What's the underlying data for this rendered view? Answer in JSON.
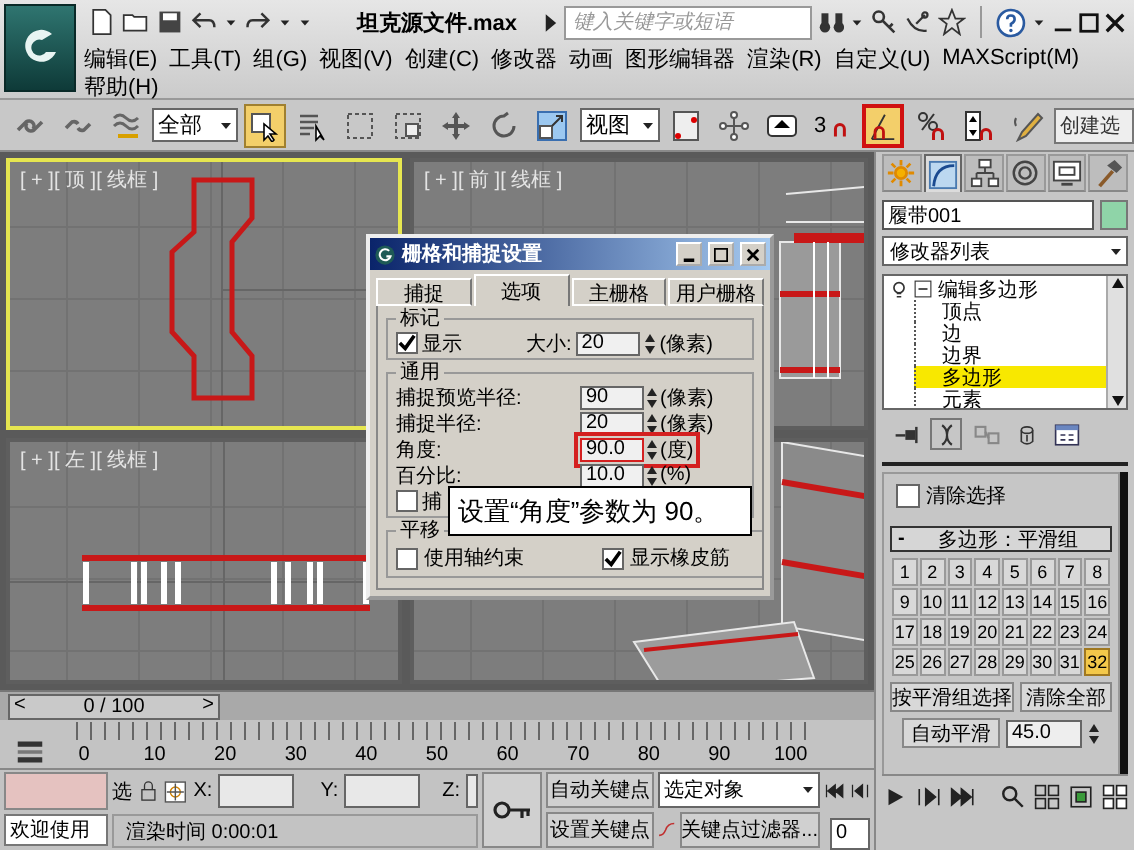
{
  "title_bar": {
    "title": "坦克源文件.max",
    "search": {
      "placeholder": "键入关键字或短语"
    }
  },
  "menu_rows": [
    [
      "编辑(E)",
      "工具(T)",
      "组(G)",
      "视图(V)",
      "创建(C)",
      "修改器",
      "动画",
      "图形编辑器",
      "渲染(R)",
      "自定义(U)",
      "MAXScript(M)"
    ],
    [
      "帮助(H)"
    ]
  ],
  "toolbar": [
    {
      "kind": "link",
      "active": false,
      "highlighted": false
    },
    {
      "kind": "unlink",
      "active": false,
      "highlighted": false
    },
    {
      "kind": "bind",
      "active": false,
      "highlighted": false
    },
    {
      "kind": "dropdown",
      "value": "全部"
    },
    {
      "kind": "select",
      "active": true,
      "highlighted": false
    },
    {
      "kind": "select_by_name",
      "active": false,
      "highlighted": false
    },
    {
      "kind": "region",
      "active": false,
      "highlighted": false
    },
    {
      "kind": "crossing",
      "active": false,
      "highlighted": false
    },
    {
      "kind": "move",
      "active": false,
      "highlighted": false
    },
    {
      "kind": "rotate",
      "active": false,
      "highlighted": false
    },
    {
      "kind": "scale",
      "active": false,
      "highlighted": false
    },
    {
      "kind": "dropdown",
      "value": "视图"
    },
    {
      "kind": "pivot",
      "active": false,
      "highlighted": false
    },
    {
      "kind": "manipulate",
      "active": false,
      "highlighted": false
    },
    {
      "kind": "keyboard",
      "active": false,
      "highlighted": false
    },
    {
      "kind": "snap",
      "label": "3",
      "active": false,
      "highlighted": false
    },
    {
      "kind": "angle_snap",
      "active": true,
      "highlighted": true
    },
    {
      "kind": "percent_snap",
      "active": false,
      "highlighted": false
    },
    {
      "kind": "spinner_snap",
      "active": false,
      "highlighted": false
    },
    {
      "kind": "named_edit",
      "active": false,
      "highlighted": false
    },
    {
      "kind": "field",
      "value": "创建选"
    }
  ],
  "viewports": [
    {
      "kind": "top",
      "label": "[ + ][ 顶 ][ 线框 ]",
      "active": true
    },
    {
      "kind": "front",
      "label": "[ + ][ 前 ][ 线框 ]",
      "active": false
    },
    {
      "kind": "left",
      "label": "[ + ][ 左 ][ 线框 ]",
      "active": false
    },
    {
      "kind": "perspective",
      "active": false
    }
  ],
  "dialog": {
    "title": "栅格和捕捉设置",
    "tabs": [
      {
        "label": "捕捉",
        "selected": false
      },
      {
        "label": "选项",
        "selected": true
      },
      {
        "label": "主栅格",
        "selected": false
      },
      {
        "label": "用户栅格",
        "selected": false
      }
    ],
    "marker": {
      "title": "标记",
      "show": {
        "label": "显示",
        "checked": true
      },
      "size": {
        "label": "大小:",
        "value": "20",
        "unit": "(像素)"
      }
    },
    "general": {
      "title": "通用",
      "fields": [
        {
          "label": "捕捉预览半径:",
          "value": "90",
          "unit": "(像素)",
          "highlighted": false
        },
        {
          "label": "捕捉半径:",
          "value": "20",
          "unit": "(像素)",
          "highlighted": false
        },
        {
          "label": "角度:",
          "value": "90.0",
          "unit": "(度)",
          "highlighted": true
        },
        {
          "label": "百分比:",
          "value": "10.0",
          "unit": "(%)",
          "highlighted": false
        }
      ],
      "options": [
        {
          "label": "捕",
          "checked": false
        }
      ]
    },
    "translation": {
      "title": "平移",
      "options": [
        {
          "label": "使用轴约束",
          "checked": false
        },
        {
          "label": "显示橡皮筋",
          "checked": true
        }
      ]
    }
  },
  "callout": {
    "text": "设置“角度”参数为 90。"
  },
  "command_panel": {
    "tabs": [
      {
        "kind": "create",
        "selected": false
      },
      {
        "kind": "modify",
        "selected": true
      },
      {
        "kind": "hierarchy",
        "selected": false
      },
      {
        "kind": "motion",
        "selected": false
      },
      {
        "kind": "display",
        "selected": false
      },
      {
        "kind": "utilities",
        "selected": false
      }
    ],
    "object_name": "履带001",
    "modifier_list": "修改器列表",
    "stack": [
      {
        "label": "编辑多边形",
        "expanded": true,
        "children": [
          {
            "label": "顶点",
            "selected": false
          },
          {
            "label": "边",
            "selected": false
          },
          {
            "label": "边界",
            "selected": false
          },
          {
            "label": "多边形",
            "selected": true
          },
          {
            "label": "元素",
            "selected": false
          }
        ]
      }
    ],
    "stack_tools": [
      {
        "kind": "pin",
        "active": false
      },
      {
        "kind": "show_end_result",
        "active": true
      },
      {
        "kind": "make_unique",
        "active": false
      },
      {
        "kind": "remove",
        "active": false
      },
      {
        "kind": "configure",
        "active": false
      }
    ],
    "clear_selection": {
      "label": "清除选择",
      "checked": false
    },
    "smoothing": {
      "toggle": "-",
      "title": "多边形：平滑组",
      "groups": [
        {
          "label": "1",
          "selected": false
        },
        {
          "label": "2",
          "selected": false
        },
        {
          "label": "3",
          "selected": false
        },
        {
          "label": "4",
          "selected": false
        },
        {
          "label": "5",
          "selected": false
        },
        {
          "label": "6",
          "selected": false
        },
        {
          "label": "7",
          "selected": false
        },
        {
          "label": "8",
          "selected": false
        },
        {
          "label": "9",
          "selected": false
        },
        {
          "label": "10",
          "selected": false
        },
        {
          "label": "11",
          "selected": false
        },
        {
          "label": "12",
          "selected": false
        },
        {
          "label": "13",
          "selected": false
        },
        {
          "label": "14",
          "selected": false
        },
        {
          "label": "15",
          "selected": false
        },
        {
          "label": "16",
          "selected": false
        },
        {
          "label": "17",
          "selected": false
        },
        {
          "label": "18",
          "selected": false
        },
        {
          "label": "19",
          "selected": false
        },
        {
          "label": "20",
          "selected": false
        },
        {
          "label": "21",
          "selected": false
        },
        {
          "label": "22",
          "selected": false
        },
        {
          "label": "23",
          "selected": false
        },
        {
          "label": "24",
          "selected": false
        },
        {
          "label": "25",
          "selected": false
        },
        {
          "label": "26",
          "selected": false
        },
        {
          "label": "27",
          "selected": false
        },
        {
          "label": "28",
          "selected": false
        },
        {
          "label": "29",
          "selected": false
        },
        {
          "label": "30",
          "selected": false
        },
        {
          "label": "31",
          "selected": false
        },
        {
          "label": "32",
          "selected": true
        }
      ],
      "select_by_group": "按平滑组选择",
      "clear_all": "清除全部",
      "auto_smooth": {
        "label": "自动平滑",
        "value": "45.0"
      }
    }
  },
  "timeline": {
    "prev": "<",
    "position": "0 / 100",
    "next": ">",
    "level": 0,
    "ticks": [
      "0",
      "10",
      "20",
      "30",
      "40",
      "50",
      "60",
      "70",
      "80",
      "90",
      "100"
    ]
  },
  "status": {
    "welcome": "欢迎使用",
    "select_label": "选",
    "x_label": "X:",
    "y_label": "Y:",
    "z_label": "Z:",
    "render_time": "渲染时间  0:00:01",
    "auto_key": "自动关键点",
    "set_key": "设置关键点",
    "key_target": "选定对象",
    "key_filters": "关键点过滤器...",
    "frame": "0"
  }
}
